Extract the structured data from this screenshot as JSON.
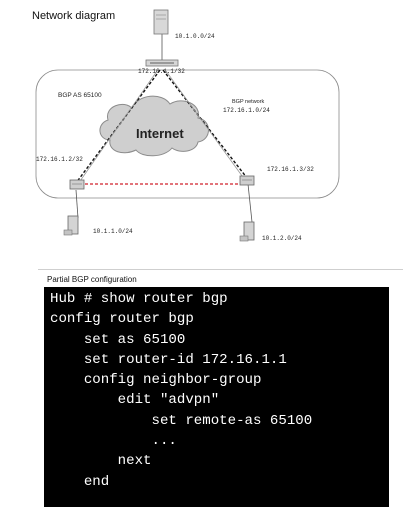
{
  "titles": {
    "network": "Network diagram",
    "config": "Partial BGP configuration"
  },
  "diagram": {
    "as_label": "BGP AS 65100",
    "bgp_network_title": "BGP network",
    "bgp_network_subnet": "172.16.1.0/24",
    "internet": "Internet",
    "hub_ip": "172.16.1.1/32",
    "top_subnet": "10.1.0.0/24",
    "left_ip": "172.16.1.2/32",
    "right_ip": "172.16.1.3/32",
    "bottom_left_subnet": "10.1.1.0/24",
    "bottom_right_subnet": "10.1.2.0/24"
  },
  "config_lines": [
    "Hub # show router bgp",
    "config router bgp",
    "    set as 65100",
    "    set router-id 172.16.1.1",
    "    config neighbor-group",
    "        edit \"advpn\"",
    "            set remote-as 65100",
    "            ...",
    "        next",
    "    end"
  ],
  "colors": {
    "console_bg": "#000000",
    "console_fg": "#ffffff",
    "tunnel_line": "#111111",
    "spoke_link": "#d0202a"
  }
}
